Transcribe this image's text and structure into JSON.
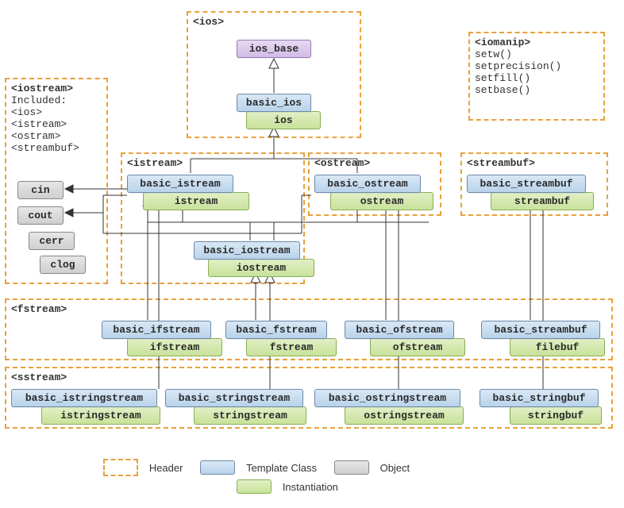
{
  "headers": {
    "ios": "<ios>",
    "iomanip": "<iomanip>",
    "iostream": "<iostream>",
    "istream": "<istream>",
    "ostream": "<ostream>",
    "streambuf": "<streambuf>",
    "fstream": "<fstream>",
    "sstream": "<sstream>"
  },
  "iomanip": {
    "fn1": "setw()",
    "fn2": "setprecision()",
    "fn3": "setfill()",
    "fn4": "setbase()"
  },
  "iostream_box": {
    "included": "Included:",
    "l1": "<ios>",
    "l2": "<istream>",
    "l3": "<ostram>",
    "l4": "<streambuf>"
  },
  "classes": {
    "ios_base": "ios_base",
    "basic_ios": "basic_ios",
    "ios": "ios",
    "basic_istream": "basic_istream",
    "istream": "istream",
    "basic_ostream": "basic_ostream",
    "ostream": "ostream",
    "basic_iostream": "basic_iostream",
    "iostream": "iostream",
    "basic_streambuf": "basic_streambuf",
    "streambuf": "streambuf",
    "basic_ifstream": "basic_ifstream",
    "ifstream": "ifstream",
    "basic_fstream": "basic_fstream",
    "fstream": "fstream",
    "basic_ofstream": "basic_ofstream",
    "ofstream": "ofstream",
    "basic_filebuf_tpl": "basic_streambuf",
    "filebuf": "filebuf",
    "basic_istringstream": "basic_istringstream",
    "istringstream": "istringstream",
    "basic_stringstream": "basic_stringstream",
    "stringstream": "stringstream",
    "basic_ostringstream": "basic_ostringstream",
    "ostringstream": "ostringstream",
    "basic_stringbuf": "basic_stringbuf",
    "stringbuf": "stringbuf"
  },
  "objects": {
    "cin": "cin",
    "cout": "cout",
    "cerr": "cerr",
    "clog": "clog"
  },
  "legend": {
    "header": "Header",
    "template": "Template Class",
    "instantiation": "Instantiation",
    "object": "Object"
  }
}
